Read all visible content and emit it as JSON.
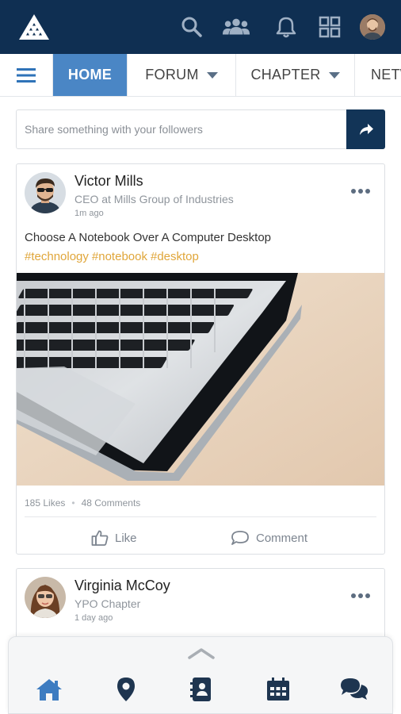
{
  "topbar": {
    "icons": [
      "logo-icon",
      "search-icon",
      "group-icon",
      "bell-icon",
      "grid-icon",
      "avatar"
    ],
    "colors": {
      "background": "#0f2f52",
      "icon": "#9fb0c4"
    }
  },
  "nav": {
    "menu_icon": "hamburger-icon",
    "tabs": [
      {
        "label": "HOME",
        "active": true
      },
      {
        "label": "FORUM",
        "active": false,
        "dropdown": true
      },
      {
        "label": "CHAPTER",
        "active": false,
        "dropdown": true
      },
      {
        "label": "NETW",
        "active": false
      }
    ],
    "colors": {
      "active": "#4a86c5"
    }
  },
  "share": {
    "placeholder": "Share something with your followers",
    "button_icon": "share-arrow-icon"
  },
  "posts": [
    {
      "author": "Victor Mills",
      "role": "CEO at Mills Group of Industries",
      "time": "1m ago",
      "text": "Choose A Notebook Over A Computer Desktop",
      "tags": [
        "#technology",
        "#notebook",
        "#desktop"
      ],
      "likes": "185 Likes",
      "comments": "48 Comments",
      "like_label": "Like",
      "comment_label": "Comment"
    },
    {
      "author": "Virginia McCoy",
      "role": "YPO Chapter",
      "time": "1 day ago"
    }
  ],
  "bottombar": {
    "icons": [
      "home-icon",
      "location-pin-icon",
      "contacts-icon",
      "calendar-icon",
      "chat-icon"
    ],
    "colors": {
      "active": "#3d7cc1",
      "inactive": "#1e3550"
    }
  }
}
